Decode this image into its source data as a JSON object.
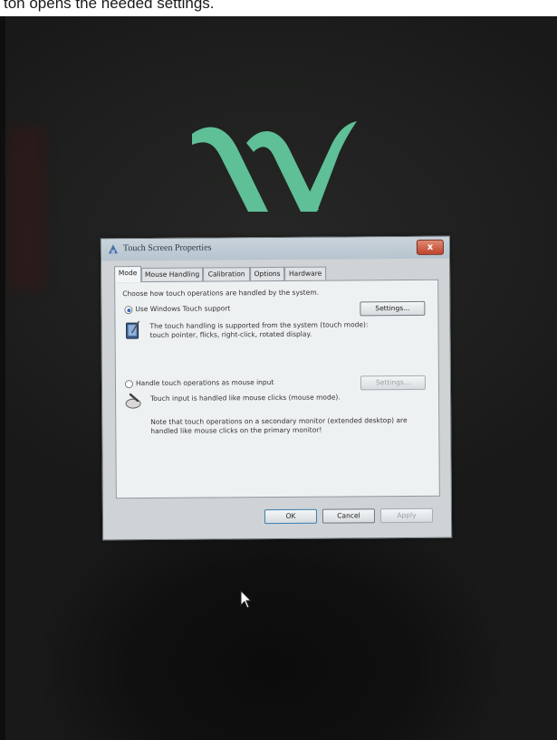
{
  "caption": "ton opens the needed settings.",
  "colors": {
    "logo": "#5fbf97",
    "dialog_bg": "#cfd3d6",
    "close": "#c0442c"
  },
  "dialog": {
    "title": "Touch Screen Properties",
    "close_label": "x",
    "tabs": [
      {
        "label": "Mode",
        "active": true
      },
      {
        "label": "Mouse Handling",
        "active": false
      },
      {
        "label": "Calibration",
        "active": false
      },
      {
        "label": "Options",
        "active": false
      },
      {
        "label": "Hardware",
        "active": false
      }
    ],
    "intro": "Choose how touch operations are handled by the system.",
    "option1": {
      "label": "Use Windows Touch support",
      "selected": true,
      "settings_label": "Settings...",
      "desc_line1": "The touch handling is supported from the system (touch mode):",
      "desc_line2": "touch pointer, flicks, right-click, rotated display."
    },
    "option2": {
      "label": "Handle touch operations as mouse input",
      "selected": false,
      "settings_label": "Settings...",
      "desc": "Touch input is handled like mouse clicks (mouse mode).",
      "note_line1": "Note that touch operations on a secondary monitor (extended desktop) are",
      "note_line2": "handled like mouse clicks on the primary monitor!"
    },
    "buttons": {
      "ok": "OK",
      "cancel": "Cancel",
      "apply": "Apply"
    }
  }
}
